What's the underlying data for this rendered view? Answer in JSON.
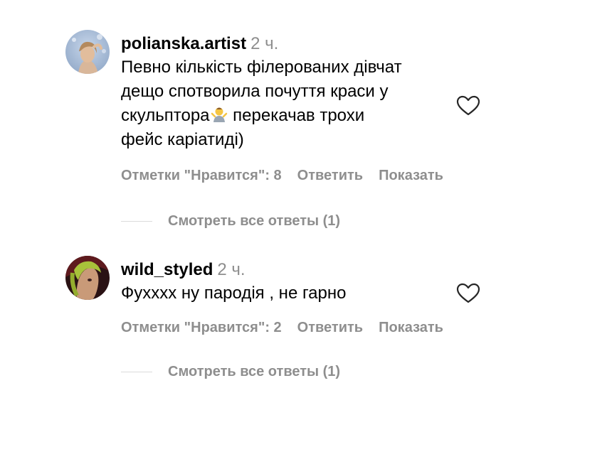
{
  "comments": [
    {
      "username": "polianska.artist",
      "time": "2 ч.",
      "text_before_emoji": "Певно кількість філерованих дівчат\nдещо спотворила почуття краси у\nскульптора",
      "emoji": "person-shrugging-emoji",
      "text_after_emoji": " перекачав трохи\nфейс каріатиді)",
      "likes_label": "Отметки \"Нравится\": 8",
      "reply_label": "Ответить",
      "more_label": "Показать",
      "view_replies_label": "Смотреть все ответы (1)",
      "avatar_icon": "avatar-photo"
    },
    {
      "username": "wild_styled",
      "time": "2 ч.",
      "text": "Фухххх ну пародія , не гарно",
      "likes_label": "Отметки \"Нравится\": 2",
      "reply_label": "Ответить",
      "more_label": "Показать",
      "view_replies_label": "Смотреть все ответы (1)",
      "avatar_icon": "avatar-photo"
    }
  ],
  "colors": {
    "primary_text": "#000000",
    "secondary_text": "#8e8e8e",
    "divider": "#dbdbdb",
    "background": "#ffffff"
  },
  "icons": {
    "like": "heart-outline-icon"
  }
}
